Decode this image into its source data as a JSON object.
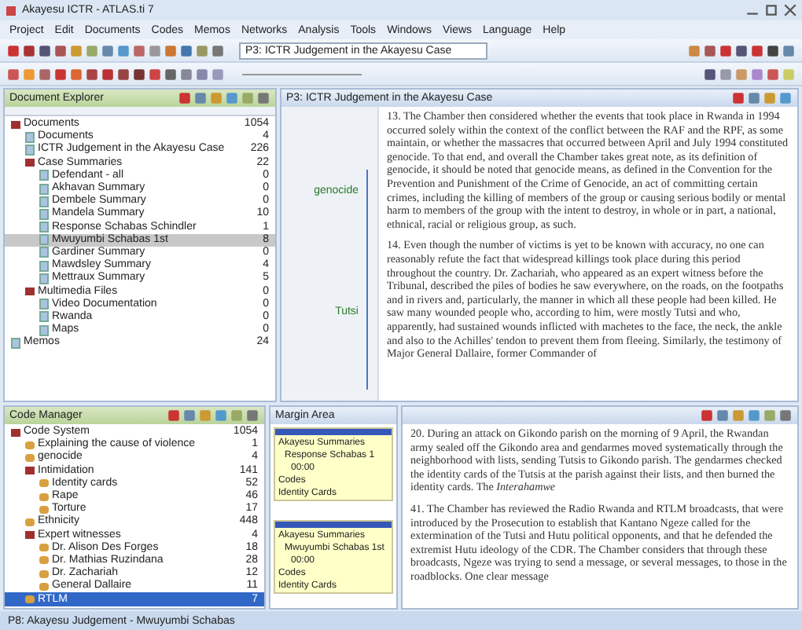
{
  "window": {
    "title": "Akayesu ICTR - ATLAS.ti 7"
  },
  "menu": [
    "Project",
    "Edit",
    "Documents",
    "Codes",
    "Memos",
    "Networks",
    "Analysis",
    "Tools",
    "Windows",
    "Views",
    "Language",
    "Help"
  ],
  "toolbar": {
    "document_select": "P3: ICTR Judgement in the Akayesu Case"
  },
  "explorer": {
    "title": "Document Explorer",
    "items": [
      {
        "label": "Documents",
        "count": "1054",
        "selected": false,
        "children": [
          {
            "label": "Documents",
            "count": "4",
            "selected": false
          },
          {
            "label": "ICTR Judgement in the Akayesu Case",
            "count": "226",
            "selected": false
          },
          {
            "label": "Case Summaries",
            "count": "22",
            "selected": false,
            "children": [
              {
                "label": "Defendant - all",
                "count": "0",
                "selected": false
              },
              {
                "label": "Akhavan Summary",
                "count": "0",
                "selected": false
              },
              {
                "label": "Dembele Summary",
                "count": "0",
                "selected": false
              },
              {
                "label": "Mandela Summary",
                "count": "10",
                "selected": false
              },
              {
                "label": "Response Schabas Schindler",
                "count": "1",
                "selected": false
              },
              {
                "label": "Mwuyumbi Schabas 1st",
                "count": "8",
                "selected": true
              },
              {
                "label": "Gardiner Summary",
                "count": "0",
                "selected": false
              },
              {
                "label": "Mawdsley Summary",
                "count": "4",
                "selected": false
              },
              {
                "label": "Mettraux Summary",
                "count": "5",
                "selected": false
              }
            ]
          },
          {
            "label": "Multimedia Files",
            "count": "0",
            "selected": false,
            "children": [
              {
                "label": "Video Documentation",
                "count": "0",
                "selected": false
              },
              {
                "label": "Rwanda",
                "count": "0",
                "selected": false
              },
              {
                "label": "Maps",
                "count": "0",
                "selected": false
              }
            ]
          }
        ]
      },
      {
        "label": "Memos",
        "count": "24",
        "selected": false
      }
    ]
  },
  "document": {
    "title": "P3: ICTR Judgement in the Akayesu Case",
    "margin_codes": [
      "genocide",
      "Tutsi"
    ],
    "paragraphs": [
      "13. The Chamber then considered whether the events that took place in Rwanda in 1994 occurred solely within the context of the conflict between the RAF and the RPF, as some maintain, or whether the massacres that occurred between April and July 1994 constituted genocide. To that end, and overall the Chamber takes great note, as its definition of genocide, it should be noted that genocide means, as defined in the Convention for the Prevention and Punishment of the Crime of Genocide, an act of committing certain crimes, including the killing of members of the group or causing serious bodily or mental harm to members of the group with the intent to destroy, in whole or in part, a national, ethnical, racial or religious group, as such.",
      "14. Even though the number of victims is yet to be known with accuracy, no one can reasonably refute the fact that widespread killings took place during this period throughout the country. Dr. Zachariah, who appeared as an expert witness before the Tribunal, described the piles of bodies he saw everywhere, on the roads, on the footpaths and in rivers and, particularly, the manner in which all these people had been killed. He saw many wounded people who, according to him, were mostly Tutsi and who, apparently, had sustained wounds inflicted with machetes to the face, the neck, the ankle and also to the Achilles' tendon to prevent them from fleeing. Similarly, the testimony of Major General Dallaire, former Commander of"
    ]
  },
  "codes": {
    "title": "Code Manager",
    "items": [
      {
        "label": "Code System",
        "count": "1054",
        "selected": false,
        "children": [
          {
            "label": "Explaining the cause of violence",
            "count": "1",
            "selected": false
          },
          {
            "label": "genocide",
            "count": "4",
            "selected": false
          },
          {
            "label": "Intimidation",
            "count": "141",
            "selected": false,
            "children": [
              {
                "label": "Identity cards",
                "count": "52",
                "selected": false
              },
              {
                "label": "Rape",
                "count": "46",
                "selected": false
              },
              {
                "label": "Torture",
                "count": "17",
                "selected": false
              }
            ]
          },
          {
            "label": "Ethnicity",
            "count": "448",
            "selected": false
          },
          {
            "label": "Expert witnesses",
            "count": "4",
            "selected": false,
            "children": [
              {
                "label": "Dr. Alison Des Forges",
                "count": "18",
                "selected": false
              },
              {
                "label": "Dr. Mathias Ruzindana",
                "count": "28",
                "selected": false
              },
              {
                "label": "Dr. Zachariah",
                "count": "12",
                "selected": false
              },
              {
                "label": "General Dallaire",
                "count": "11",
                "selected": false
              }
            ]
          },
          {
            "label": "RTLM",
            "count": "7",
            "selected": true
          }
        ]
      }
    ]
  },
  "margin": {
    "title": "Margin Area",
    "segments": [
      {
        "document": "Akayesu Summaries",
        "source": "Response Schabas 1",
        "time": "00:00",
        "category": "Codes",
        "code": "Identity Cards"
      },
      {
        "document": "Akayesu Summaries",
        "source": "Mwuyumbi Schabas 1st",
        "time": "00:00",
        "category": "Codes",
        "code": "Identity Cards"
      }
    ]
  },
  "document2": {
    "paragraphs": [
      "20. During an attack on Gikondo parish on the morning of 9 April, the Rwandan army sealed off the Gikondo area and gendarmes moved systematically through the neighborhood with lists, sending Tutsis to Gikondo parish. The gendarmes checked the identity cards of the Tutsis at the parish against their lists, and then burned the identity cards. The *Interahamwe*",
      "41. The Chamber has reviewed the Radio Rwanda and RTLM broadcasts, that were introduced by the Prosecution to establish that Kantano Ngeze called for the extermination of the Tutsi and Hutu political opponents, and that he defended the extremist Hutu ideology of the CDR. The Chamber considers that through these broadcasts, Ngeze was trying to send a message, or several messages, to those in the roadblocks. One clear message"
    ]
  },
  "status_bar": {
    "text": "P8: Akayesu Judgement - Mwuyumbi Schabas"
  }
}
